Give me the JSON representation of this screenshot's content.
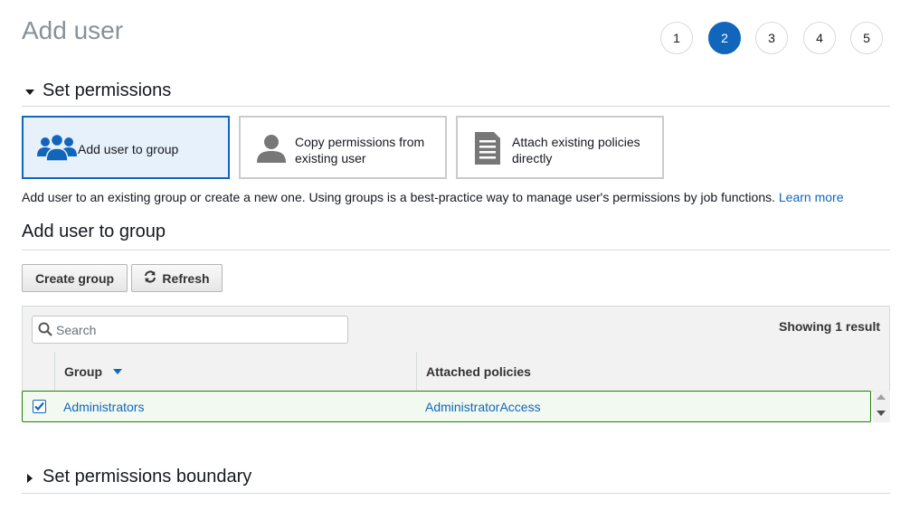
{
  "page": {
    "title": "Add user"
  },
  "steps": [
    "1",
    "2",
    "3",
    "4",
    "5"
  ],
  "active_step": "2",
  "set_permissions": {
    "title": "Set permissions",
    "options": [
      {
        "label": "Add user to group",
        "icon": "user-group-icon"
      },
      {
        "label": "Copy permissions from existing user",
        "icon": "user-icon"
      },
      {
        "label": "Attach existing policies directly",
        "icon": "document-icon"
      }
    ],
    "selected": "Add user to group",
    "description": "Add user to an existing group or create a new one. Using groups is a best-practice way to manage user's permissions by job functions.",
    "learn_more": "Learn more"
  },
  "add_user_to_group": {
    "title": "Add user to group",
    "create_group_label": "Create group",
    "refresh_label": "Refresh",
    "search_placeholder": "Search",
    "showing": "Showing 1 result",
    "columns": {
      "group": "Group",
      "policies": "Attached policies"
    },
    "rows": [
      {
        "group": "Administrators",
        "policies": "AdministratorAccess",
        "checked": true
      }
    ]
  },
  "boundary": {
    "title": "Set permissions boundary"
  },
  "colors": {
    "accent": "#1166bb",
    "selected_bg": "#e7f1fb",
    "row_border": "#1d8102"
  }
}
